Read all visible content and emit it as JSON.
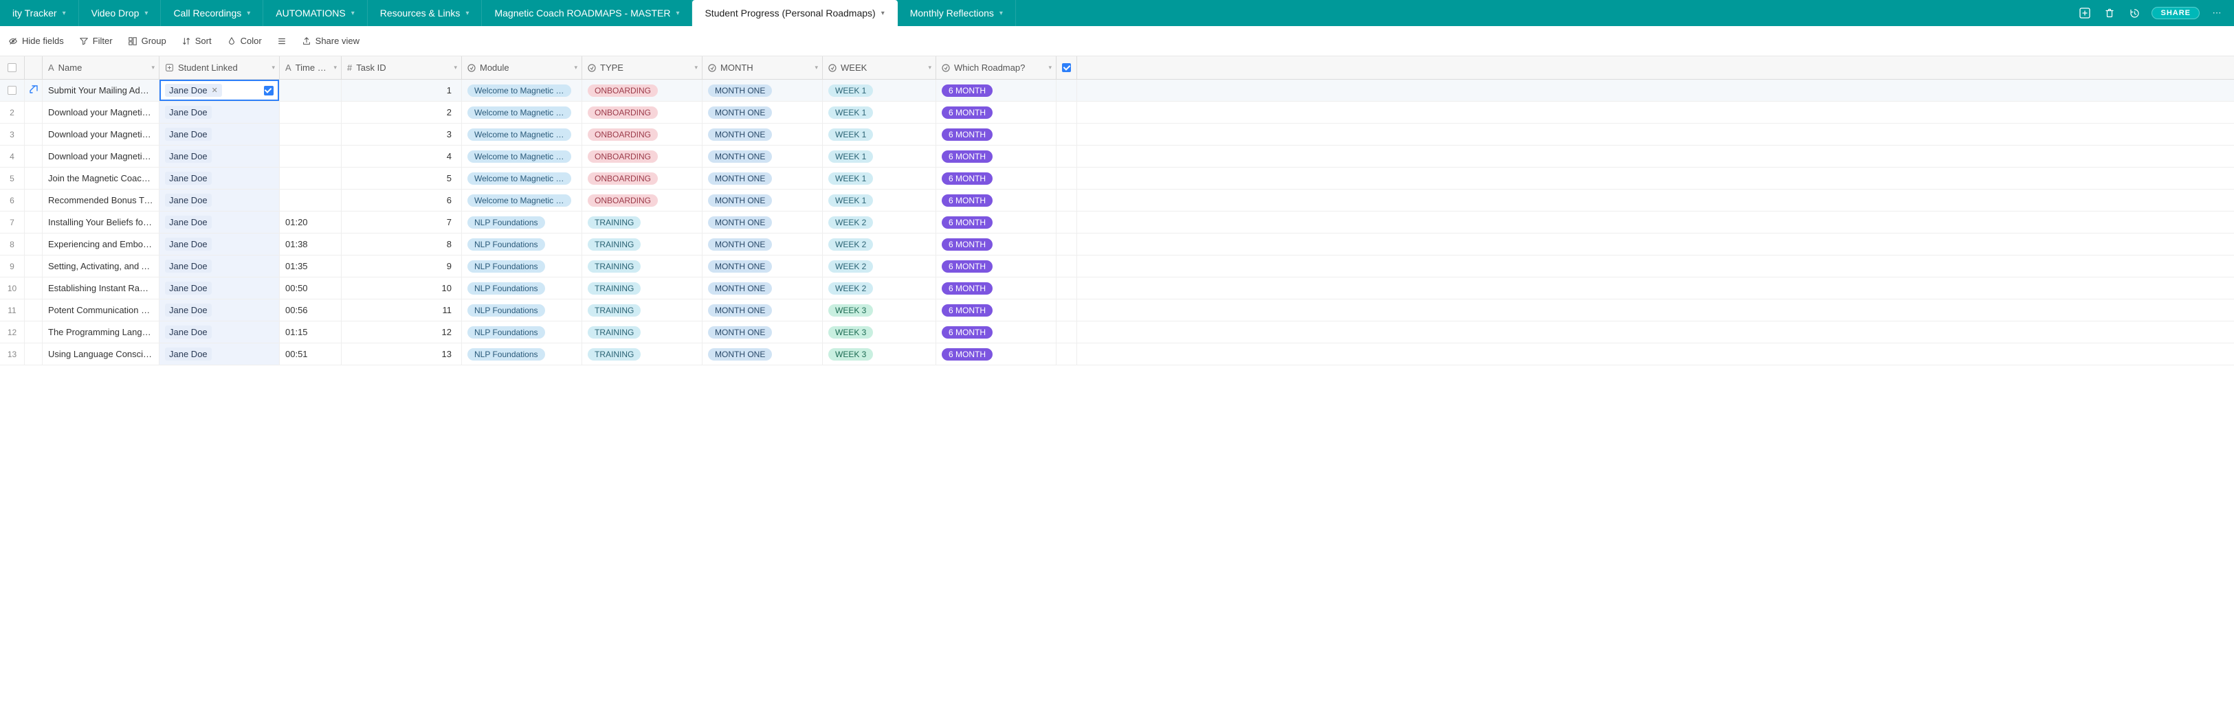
{
  "tabs": [
    {
      "label": "ity Tracker",
      "active": false
    },
    {
      "label": "Video Drop",
      "active": false
    },
    {
      "label": "Call Recordings",
      "active": false
    },
    {
      "label": "AUTOMATIONS",
      "active": false
    },
    {
      "label": "Resources & Links",
      "active": false
    },
    {
      "label": "Magnetic Coach ROADMAPS - MASTER",
      "active": false
    },
    {
      "label": "Student Progress (Personal Roadmaps)",
      "active": true
    },
    {
      "label": "Monthly Reflections",
      "active": false
    }
  ],
  "share_label": "SHARE",
  "toolbar": {
    "hide_fields": "Hide fields",
    "filter": "Filter",
    "group": "Group",
    "sort": "Sort",
    "color": "Color",
    "share_view": "Share view"
  },
  "columns": {
    "name": "Name",
    "student": "Student Linked",
    "time": "Time …",
    "taskid": "Task ID",
    "module": "Module",
    "type": "TYPE",
    "month": "MONTH",
    "week": "WEEK",
    "roadmap": "Which Roadmap?"
  },
  "rows": [
    {
      "n": "",
      "name": "Submit Your Mailing Addr…",
      "student": "Jane Doe",
      "time": "",
      "taskid": "1",
      "module": "Welcome to Magnetic …",
      "type": "ONBOARDING",
      "month": "MONTH ONE",
      "week": "WEEK 1",
      "week_style": "ltblue",
      "roadmap": "6 MONTH",
      "first": true
    },
    {
      "n": "2",
      "name": "Download your Magnetic …",
      "student": "Jane Doe",
      "time": "",
      "taskid": "2",
      "module": "Welcome to Magnetic …",
      "type": "ONBOARDING",
      "month": "MONTH ONE",
      "week": "WEEK 1",
      "week_style": "ltblue",
      "roadmap": "6 MONTH"
    },
    {
      "n": "3",
      "name": "Download your Magnetic …",
      "student": "Jane Doe",
      "time": "",
      "taskid": "3",
      "module": "Welcome to Magnetic …",
      "type": "ONBOARDING",
      "month": "MONTH ONE",
      "week": "WEEK 1",
      "week_style": "ltblue",
      "roadmap": "6 MONTH"
    },
    {
      "n": "4",
      "name": "Download your Magnetic …",
      "student": "Jane Doe",
      "time": "",
      "taskid": "4",
      "module": "Welcome to Magnetic …",
      "type": "ONBOARDING",
      "month": "MONTH ONE",
      "week": "WEEK 1",
      "week_style": "ltblue",
      "roadmap": "6 MONTH"
    },
    {
      "n": "5",
      "name": "Join the Magnetic Coach…",
      "student": "Jane Doe",
      "time": "",
      "taskid": "5",
      "module": "Welcome to Magnetic …",
      "type": "ONBOARDING",
      "month": "MONTH ONE",
      "week": "WEEK 1",
      "week_style": "ltblue",
      "roadmap": "6 MONTH"
    },
    {
      "n": "6",
      "name": "Recommended Bonus Tra…",
      "student": "Jane Doe",
      "time": "",
      "taskid": "6",
      "module": "Welcome to Magnetic …",
      "type": "ONBOARDING",
      "month": "MONTH ONE",
      "week": "WEEK 1",
      "week_style": "ltblue",
      "roadmap": "6 MONTH"
    },
    {
      "n": "7",
      "name": "Installing Your Beliefs for …",
      "student": "Jane Doe",
      "time": "01:20",
      "taskid": "7",
      "module": "NLP Foundations",
      "type": "TRAINING",
      "month": "MONTH ONE",
      "week": "WEEK 2",
      "week_style": "ltblue",
      "roadmap": "6 MONTH"
    },
    {
      "n": "8",
      "name": "Experiencing and Embod…",
      "student": "Jane Doe",
      "time": "01:38",
      "taskid": "8",
      "module": "NLP Foundations",
      "type": "TRAINING",
      "month": "MONTH ONE",
      "week": "WEEK 2",
      "week_style": "ltblue",
      "roadmap": "6 MONTH"
    },
    {
      "n": "9",
      "name": "Setting, Activating, and A…",
      "student": "Jane Doe",
      "time": "01:35",
      "taskid": "9",
      "module": "NLP Foundations",
      "type": "TRAINING",
      "month": "MONTH ONE",
      "week": "WEEK 2",
      "week_style": "ltblue",
      "roadmap": "6 MONTH"
    },
    {
      "n": "10",
      "name": "Establishing Instant Rapp…",
      "student": "Jane Doe",
      "time": "00:50",
      "taskid": "10",
      "module": "NLP Foundations",
      "type": "TRAINING",
      "month": "MONTH ONE",
      "week": "WEEK 2",
      "week_style": "ltblue",
      "roadmap": "6 MONTH"
    },
    {
      "n": "11",
      "name": "Potent Communication C…",
      "student": "Jane Doe",
      "time": "00:56",
      "taskid": "11",
      "module": "NLP Foundations",
      "type": "TRAINING",
      "month": "MONTH ONE",
      "week": "WEEK 3",
      "week_style": "mint",
      "roadmap": "6 MONTH"
    },
    {
      "n": "12",
      "name": "The Programming Langua…",
      "student": "Jane Doe",
      "time": "01:15",
      "taskid": "12",
      "module": "NLP Foundations",
      "type": "TRAINING",
      "month": "MONTH ONE",
      "week": "WEEK 3",
      "week_style": "mint",
      "roadmap": "6 MONTH"
    },
    {
      "n": "13",
      "name": "Using Language Conscio…",
      "student": "Jane Doe",
      "time": "00:51",
      "taskid": "13",
      "module": "NLP Foundations",
      "type": "TRAINING",
      "month": "MONTH ONE",
      "week": "WEEK 3",
      "week_style": "mint",
      "roadmap": "6 MONTH"
    }
  ]
}
